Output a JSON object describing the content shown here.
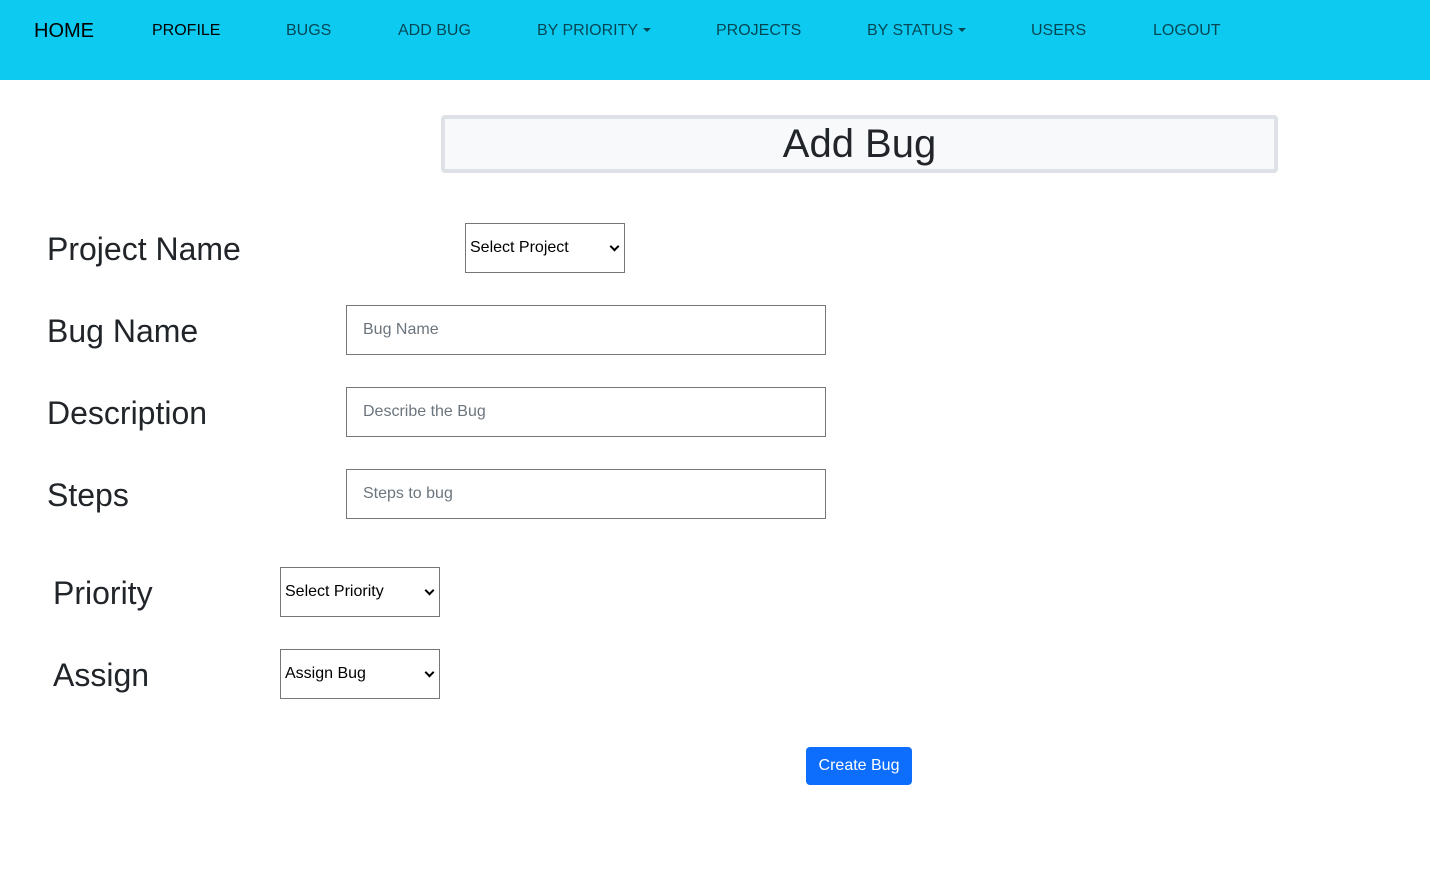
{
  "nav": {
    "brand": "HOME",
    "items": [
      {
        "label": "PROFILE"
      },
      {
        "label": "BUGS"
      },
      {
        "label": "ADD BUG"
      },
      {
        "label": "BY PRIORITY"
      },
      {
        "label": "PROJECTS"
      },
      {
        "label": "BY STATUS"
      },
      {
        "label": "USERS"
      },
      {
        "label": "LOGOUT"
      }
    ]
  },
  "page": {
    "title": "Add Bug"
  },
  "form": {
    "project": {
      "label": "Project Name",
      "selected": "Select Project"
    },
    "bug_name": {
      "label": "Bug Name",
      "placeholder": "Bug Name",
      "value": ""
    },
    "description": {
      "label": "Description",
      "placeholder": "Describe the Bug",
      "value": ""
    },
    "steps": {
      "label": "Steps",
      "placeholder": "Steps to bug",
      "value": ""
    },
    "priority": {
      "label": "Priority",
      "selected": "Select Priority"
    },
    "assign": {
      "label": "Assign",
      "selected": "Assign Bug"
    },
    "submit_label": "Create Bug"
  },
  "colors": {
    "navbar": "#0dcaf0",
    "primary": "#0d6efd"
  }
}
